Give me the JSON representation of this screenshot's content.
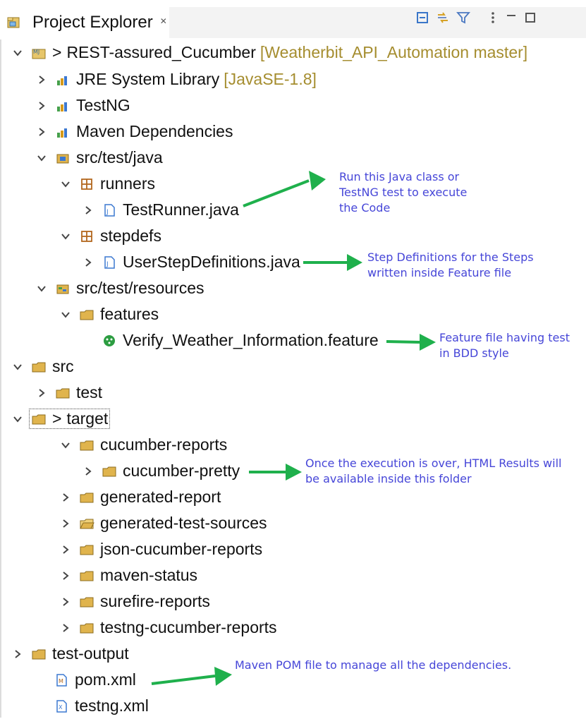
{
  "header": {
    "title": "Project Explorer",
    "close_symbol": "✕",
    "toolbar": {
      "collapse_all": "collapse-all-icon",
      "link_with_editor": "link-with-editor-icon",
      "filter": "filter-icon",
      "view_menu": "view-menu-icon",
      "minimize": "minimize-icon",
      "maximize": "maximize-icon"
    }
  },
  "tree": {
    "project": {
      "prefix": ">",
      "label": "REST-assured_Cucumber",
      "decoration": "[Weatherbit_API_Automation master]"
    },
    "items": [
      {
        "label": "JRE System Library",
        "decoration": "[JavaSE-1.8]"
      },
      {
        "label": "TestNG"
      },
      {
        "label": "Maven Dependencies"
      },
      {
        "label": "src/test/java"
      },
      {
        "label": "runners"
      },
      {
        "label": "TestRunner.java"
      },
      {
        "label": "stepdefs"
      },
      {
        "label": "UserStepDefinitions.java"
      },
      {
        "label": "src/test/resources"
      },
      {
        "label": "features"
      },
      {
        "label": "Verify_Weather_Information.feature"
      },
      {
        "label": "src"
      },
      {
        "label": "test"
      },
      {
        "prefix": ">",
        "label": "target"
      },
      {
        "label": "cucumber-reports"
      },
      {
        "label": "cucumber-pretty"
      },
      {
        "label": "generated-report"
      },
      {
        "label": "generated-test-sources"
      },
      {
        "label": "json-cucumber-reports"
      },
      {
        "label": "maven-status"
      },
      {
        "label": "surefire-reports"
      },
      {
        "label": "testng-cucumber-reports"
      },
      {
        "label": "test-output"
      },
      {
        "label": "pom.xml"
      },
      {
        "label": "testng.xml"
      }
    ]
  },
  "annotations": {
    "runner_line_1": "Run this Java class or",
    "runner_line_2": "TestNG test to execute",
    "runner_line_3": "the Code",
    "steps_line_1": "Step Definitions for the Steps",
    "steps_line_2": "written inside Feature file",
    "feature_line_1": "Feature file having test",
    "feature_line_2": "in BDD style",
    "reports_line_1": "Once the execution is over, HTML Results will",
    "reports_line_2": "be available inside this folder",
    "pom_line_1": "Maven POM file to manage all the dependencies."
  },
  "colors": {
    "annotation_text": "#4646d8",
    "arrow": "#1fb04c",
    "decoration": "#a58d2f",
    "folder": "#e0b44d",
    "package": "#b2671d",
    "java_file": "#3b78d1",
    "library": "#47a04a",
    "feature_icon": "#2c9d41"
  }
}
